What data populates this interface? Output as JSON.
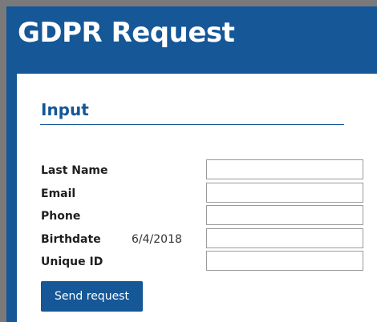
{
  "app": {
    "title": "GDPR Request"
  },
  "section": {
    "title": "Input"
  },
  "form": {
    "last_name": {
      "label": "Last Name",
      "value": "",
      "display": ""
    },
    "email": {
      "label": "Email",
      "value": "",
      "display": ""
    },
    "phone": {
      "label": "Phone",
      "value": "",
      "display": ""
    },
    "birthdate": {
      "label": "Birthdate",
      "value": "",
      "display": "6/4/2018"
    },
    "unique_id": {
      "label": "Unique ID",
      "value": "",
      "display": ""
    }
  },
  "actions": {
    "send_label": "Send request"
  },
  "colors": {
    "brand": "#155797",
    "panel": "#ffffff",
    "backdrop": "#7a7a7a"
  }
}
